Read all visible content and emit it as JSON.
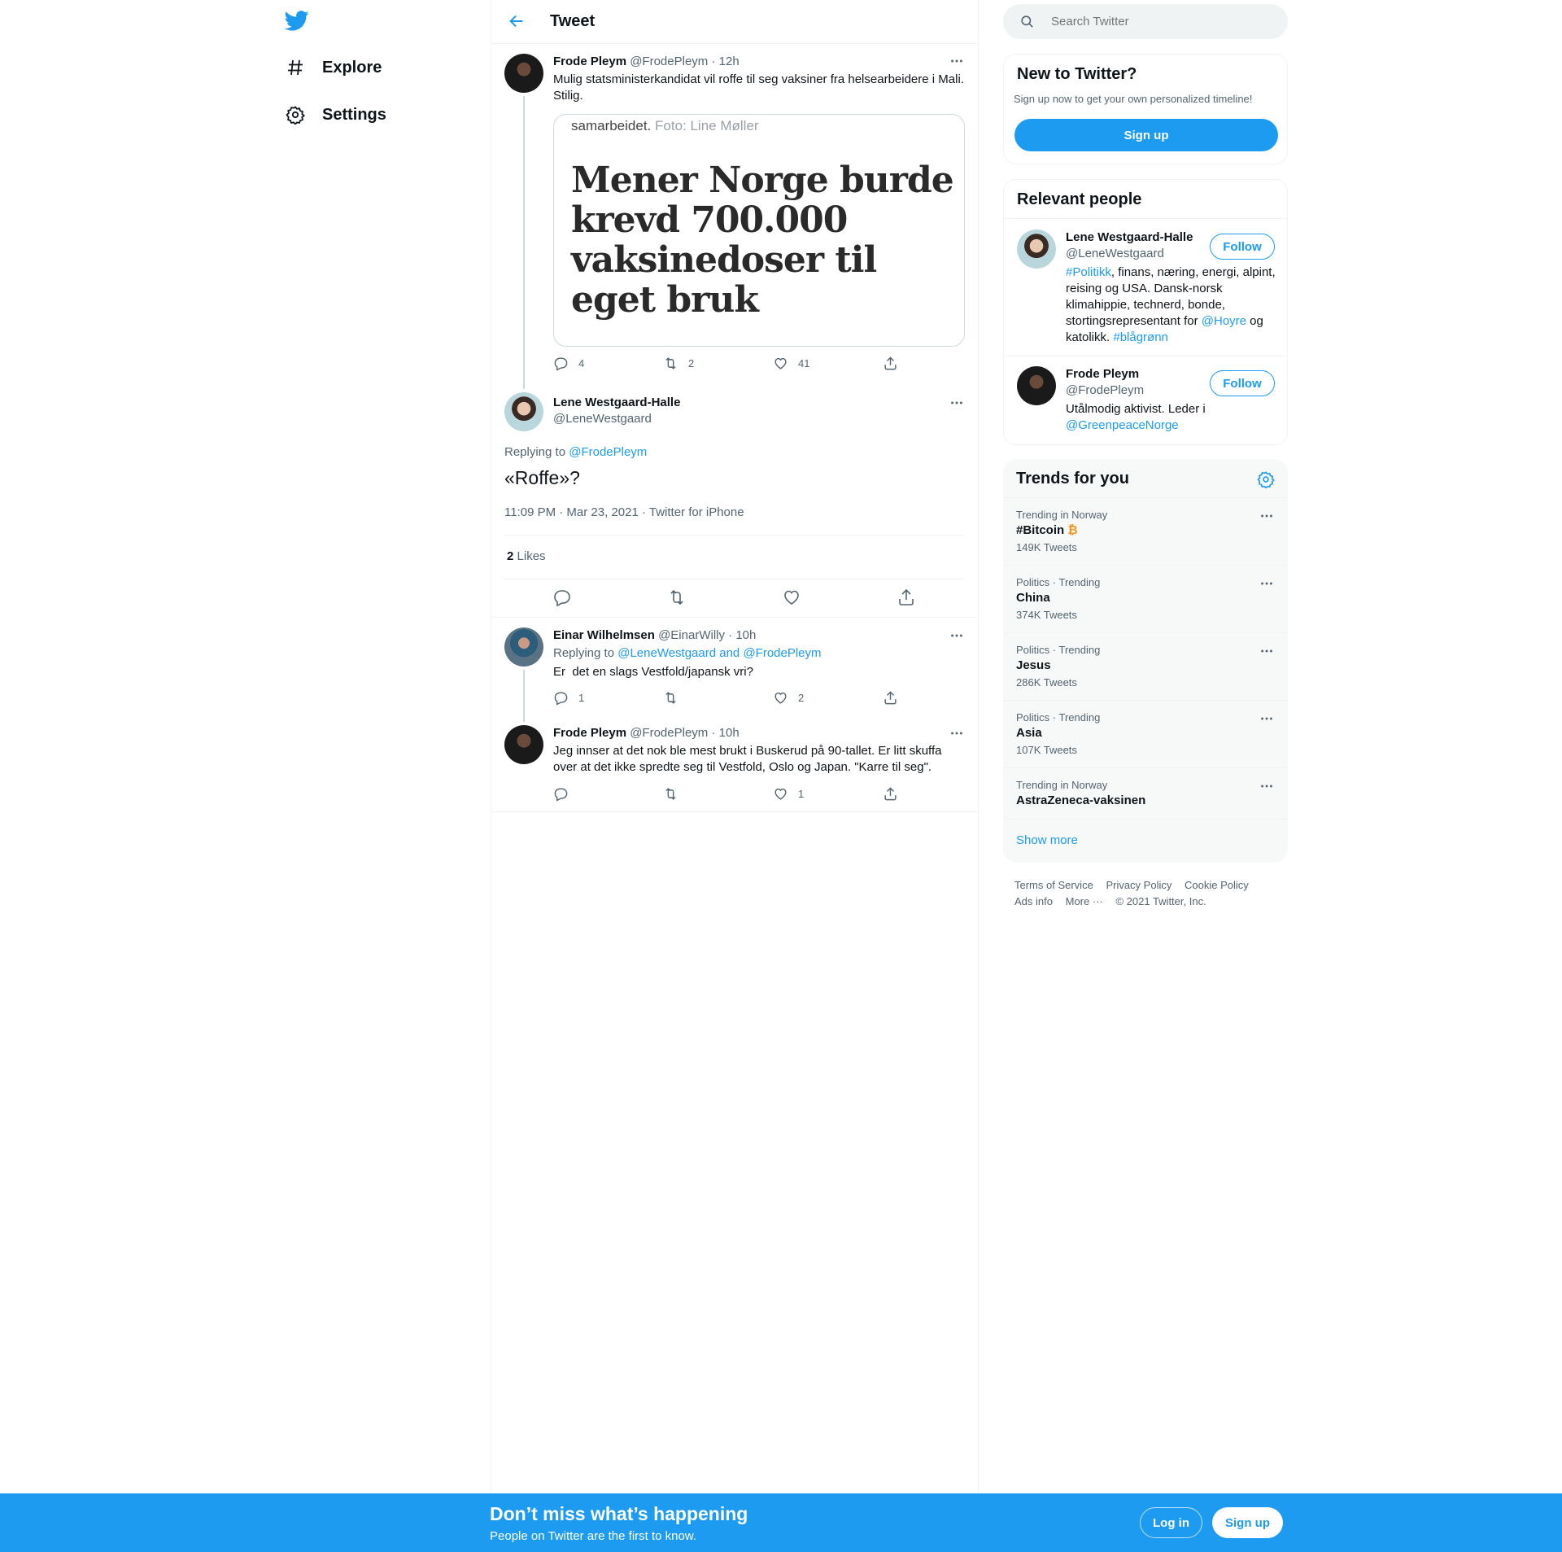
{
  "nav": {
    "items": [
      {
        "label": "Explore"
      },
      {
        "label": "Settings"
      }
    ]
  },
  "header": {
    "title": "Tweet"
  },
  "thread": {
    "parent": {
      "name": "Frode Pleym",
      "handle": "@FrodePleym",
      "time": "· 12h",
      "text": "Mulig statsministerkandidat vil roffe til seg vaksiner fra helsearbeidere i Mali. Stilig.",
      "card": {
        "caption": "samarbeidet.",
        "caption_credit": "Foto: Line Møller",
        "headline": "Mener Norge burde krevd 700.000 vaksinedoser til eget bruk"
      },
      "replies": "4",
      "retweets": "2",
      "likes": "41"
    },
    "focus": {
      "name": "Lene Westgaard-Halle",
      "handle": "@LeneWestgaard",
      "replying_prefix": "Replying to",
      "replying_to": "@FrodePleym",
      "text": "«Roffe»?",
      "meta": "11:09 PM · Mar 23, 2021 · Twitter for iPhone",
      "likes_count": "2",
      "likes_label": "Likes"
    },
    "replies": [
      {
        "name": "Einar Wilhelmsen",
        "handle": "@EinarWilly",
        "time": "· 10h",
        "replying_prefix": "Replying to",
        "replying_to": "@LeneWestgaard and @FrodePleym",
        "text": "Er  det en slags Vestfold/japansk vri?",
        "replies": "1",
        "retweets": "",
        "likes": "2"
      },
      {
        "name": "Frode Pleym",
        "handle": "@FrodePleym",
        "time": "· 10h",
        "text": "Jeg innser at det nok ble mest brukt i Buskerud på 90-tallet. Er litt skuffa over at det ikke spredte seg til Vestfold, Oslo og Japan. \"Karre til seg\".",
        "replies": "",
        "retweets": "",
        "likes": "1"
      }
    ]
  },
  "search": {
    "placeholder": "Search Twitter"
  },
  "new_to_twitter": {
    "title": "New to Twitter?",
    "subtitle": "Sign up now to get your own personalized timeline!",
    "button": "Sign up"
  },
  "relevant": {
    "title": "Relevant people",
    "follow_label": "Follow",
    "people": [
      {
        "name": "Lene Westgaard-Halle",
        "handle": "@LeneWestgaard",
        "bio_parts": [
          "#Politikk",
          ", finans, næring, energi, alpint, reising og USA. Dansk-norsk klimahippie, technerd, bonde, stortingsrepresentant for ",
          "@Hoyre",
          " og katolikk. ",
          "#blågrønn"
        ]
      },
      {
        "name": "Frode Pleym",
        "handle": "@FrodePleym",
        "bio_parts": [
          "Utålmodig aktivist. Leder i ",
          "@GreenpeaceNorge"
        ]
      }
    ]
  },
  "trends": {
    "title": "Trends for you",
    "items": [
      {
        "context": "Trending in Norway",
        "name": "#Bitcoin",
        "badge": "₿",
        "count": "149K Tweets"
      },
      {
        "context": "Politics · Trending",
        "name": "China",
        "count": "374K Tweets"
      },
      {
        "context": "Politics · Trending",
        "name": "Jesus",
        "count": "286K Tweets"
      },
      {
        "context": "Politics · Trending",
        "name": "Asia",
        "count": "107K Tweets"
      },
      {
        "context": "Trending in Norway",
        "name": "AstraZeneca-vaksinen",
        "count": ""
      }
    ],
    "show_more": "Show more"
  },
  "footer": {
    "links": [
      "Terms of Service",
      "Privacy Policy",
      "Cookie Policy",
      "Ads info",
      "More ···"
    ],
    "copyright": "© 2021 Twitter, Inc."
  },
  "bottom_bar": {
    "title": "Don’t miss what’s happening",
    "subtitle": "People on Twitter are the first to know.",
    "login": "Log in",
    "signup": "Sign up"
  },
  "colors": {
    "accent": "#1d9bf0",
    "text": "#0f1419",
    "secondary": "#536471",
    "border": "#eff3f4",
    "bitcoin": "#f7931a"
  },
  "icons": [
    "twitter-logo-icon",
    "hashtag-icon",
    "gear-icon",
    "back-arrow-icon",
    "more-dots-icon",
    "reply-icon",
    "retweet-icon",
    "like-icon",
    "share-icon",
    "search-icon"
  ]
}
